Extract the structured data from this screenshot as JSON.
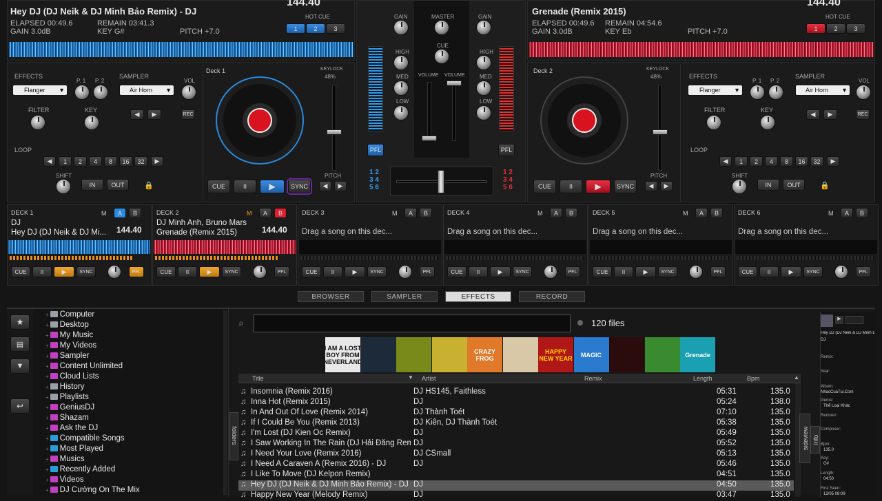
{
  "deck1": {
    "title": "Hey DJ (DJ Neik & DJ Minh Bảo Remix) - DJ",
    "bpm": "144.40",
    "elapsed": "ELAPSED 00:49.6",
    "remain": "REMAIN 03:41.3",
    "gain": "GAIN 3.0dB",
    "key": "KEY G#",
    "pitch": "PITCH +7.0",
    "deck_label": "Deck 1",
    "keylock_pct": "48%",
    "keylock": "KEYLOCK",
    "effect": "Flanger",
    "sampler": "Air Horn"
  },
  "deck2": {
    "title": "Grenade (Remix 2015)",
    "bpm": "144.40",
    "elapsed": "ELAPSED 00:49.6",
    "remain": "REMAIN 04:54.6",
    "gain": "GAIN 3.0dB",
    "key": "KEY Eb",
    "pitch": "PITCH +7.0",
    "deck_label": "Deck 2",
    "keylock_pct": "48%",
    "keylock": "KEYLOCK",
    "effect": "Flanger",
    "sampler": "Air Horn"
  },
  "labels": {
    "hot_cue": "HOT CUE",
    "effects": "EFFECTS",
    "sampler": "SAMPLER",
    "filter": "FILTER",
    "key": "KEY",
    "loop": "LOOP",
    "shift": "SHIFT",
    "vol": "VOL",
    "p1": "P. 1",
    "p2": "P. 2",
    "in": "IN",
    "out": "OUT",
    "rec": "REC",
    "pitch": "PITCH",
    "cue": "CUE",
    "pause": "II",
    "sync": "SYNC",
    "gain": "GAIN",
    "master": "MASTER",
    "high": "HIGH",
    "med": "MED",
    "low": "LOW",
    "volume": "VOLUME",
    "pfl": "PFL",
    "m": "M",
    "a": "A",
    "b": "B",
    "hc1": "1",
    "hc2": "2",
    "hc3": "3",
    "cf_left": "1 2\n3 4\n5 6",
    "cf_right": "1 2\n3 4\n5 6"
  },
  "loop_sizes": [
    "1",
    "2",
    "4",
    "8",
    "16",
    "32"
  ],
  "mini_decks": [
    {
      "name": "DECK 1",
      "line1": "DJ",
      "line2": "Hey DJ (DJ Neik & DJ Mi...",
      "bpm": "144.40"
    },
    {
      "name": "DECK 2",
      "line1": "DJ Minh Anh, Bruno Mars",
      "line2": "Grenade (Remix 2015)",
      "bpm": "144.40"
    },
    {
      "name": "DECK 3",
      "line1": "Drag a song on this dec..."
    },
    {
      "name": "DECK 4",
      "line1": "Drag a song on this dec..."
    },
    {
      "name": "DECK 5",
      "line1": "Drag a song on this dec..."
    },
    {
      "name": "DECK 6",
      "line1": "Drag a song on this dec..."
    }
  ],
  "tabs": [
    "BROWSER",
    "SAMPLER",
    "EFFECTS",
    "RECORD"
  ],
  "tree": [
    {
      "label": "Computer",
      "color": "#9aa0a6"
    },
    {
      "label": "Desktop",
      "color": "#9aa0a6"
    },
    {
      "label": "My Music",
      "color": "#c040c0"
    },
    {
      "label": "My Videos",
      "color": "#c040c0"
    },
    {
      "label": "Sampler",
      "color": "#c040c0"
    },
    {
      "label": "Content Unlimited",
      "color": "#c040c0"
    },
    {
      "label": "Cloud Lists",
      "color": "#c040c0"
    },
    {
      "label": "History",
      "color": "#9aa0a6"
    },
    {
      "label": "Playlists",
      "color": "#9aa0a6"
    },
    {
      "label": "GeniusDJ",
      "color": "#c040c0"
    },
    {
      "label": "Shazam",
      "color": "#c040c0"
    },
    {
      "label": "Ask the DJ",
      "color": "#c040c0"
    },
    {
      "label": "Compatible Songs",
      "color": "#2a9cd8"
    },
    {
      "label": "Most Played",
      "color": "#2a9cd8"
    },
    {
      "label": "Musics",
      "color": "#c040c0"
    },
    {
      "label": "Recently Added",
      "color": "#2a9cd8"
    },
    {
      "label": "Videos",
      "color": "#c040c0"
    },
    {
      "label": "DJ Cường On The Mix",
      "color": "#c040c0"
    }
  ],
  "search": {
    "value": "",
    "count": "120 files"
  },
  "covers": [
    {
      "text": "I AM A LOST BOY FROM NEVERLAND",
      "bg": "#e8e8e8",
      "fg": "#111"
    },
    {
      "text": "",
      "bg": "#1c2a3a",
      "fg": "#ccc"
    },
    {
      "text": "",
      "bg": "#7a8a1a",
      "fg": "#eee"
    },
    {
      "text": "",
      "bg": "#c8b030",
      "fg": "#333"
    },
    {
      "text": "CRAZY FROG",
      "bg": "#e07a2a",
      "fg": "#fff"
    },
    {
      "text": "",
      "bg": "#d8c8a8",
      "fg": "#333"
    },
    {
      "text": "HAPPY NEW YEAR",
      "bg": "#b01818",
      "fg": "#ffd400"
    },
    {
      "text": "MAGIC",
      "bg": "#2a7ad0",
      "fg": "#fff"
    },
    {
      "text": "",
      "bg": "#2a0c0c",
      "fg": "#f60"
    },
    {
      "text": "",
      "bg": "#3a8a30",
      "fg": "#ff3"
    },
    {
      "text": "Grenade",
      "bg": "#1aa0b0",
      "fg": "#fff"
    }
  ],
  "columns": {
    "title": "Title",
    "artist": "Artist",
    "remix": "Remix",
    "length": "Length",
    "bpm": "Bpm"
  },
  "tracks": [
    {
      "title": "Insomnia (Remix 2016)",
      "artist": "DJ HS145, Faithless",
      "length": "05:31",
      "bpm": "135.0"
    },
    {
      "title": "Inna Hot (Remix 2015)",
      "artist": "DJ",
      "length": "05:24",
      "bpm": "138.0"
    },
    {
      "title": "In And Out Of Love (Remix 2014)",
      "artist": "DJ Thành Toét",
      "length": "07:10",
      "bpm": "135.0"
    },
    {
      "title": "If I Could Be You (Remix 2013)",
      "artist": "DJ Kiên, DJ Thành Toét",
      "length": "05:38",
      "bpm": "135.0"
    },
    {
      "title": "I'm Lost (DJ Kien Oc Remix)",
      "artist": "DJ",
      "length": "05:49",
      "bpm": "135.0"
    },
    {
      "title": "I Saw Working In The Rain (DJ Hải Đăng Remix)",
      "artist": "DJ",
      "length": "05:52",
      "bpm": "135.0"
    },
    {
      "title": "I Need Your Love (Remix 2016)",
      "artist": "DJ CSmall",
      "length": "05:13",
      "bpm": "135.0"
    },
    {
      "title": "I Need A Caraven A (Remix 2016) - DJ",
      "artist": "DJ",
      "length": "05:46",
      "bpm": "135.0"
    },
    {
      "title": "I Like To Move (DJ Kelpon Remix)",
      "artist": "",
      "length": "04:51",
      "bpm": "135.0"
    },
    {
      "title": "Hey DJ (DJ Neik & DJ Minh Bảo Remix) - DJ",
      "artist": "DJ",
      "length": "04:50",
      "bpm": "135.0",
      "selected": true
    },
    {
      "title": "Happy New Year (Melody Remix)",
      "artist": "DJ",
      "length": "03:47",
      "bpm": "135.0"
    }
  ],
  "side_tabs": {
    "folders": "folders",
    "sideview": "sideview",
    "info": "info"
  },
  "info": {
    "artist_line": "Hey DJ (DJ Neik & DJ Minh Bảo Remix) - DJ",
    "artist2": "DJ",
    "remix_label": "Remix:",
    "year_label": "Year:",
    "album_label": "Album:",
    "album": "NhacCuaTui.Com",
    "genre_label": "Genre:",
    "genre": "Thể Loại Khác",
    "remixer_label": "Remixer:",
    "composer_label": "Composer:",
    "bpm_label": "Bpm:",
    "bpm": "135.0",
    "key_label": "Key:",
    "key": "G#",
    "length_label": "Length:",
    "length": "04:50",
    "first_seen_label": "First Seen:",
    "first_seen": "12/05 08:09"
  }
}
